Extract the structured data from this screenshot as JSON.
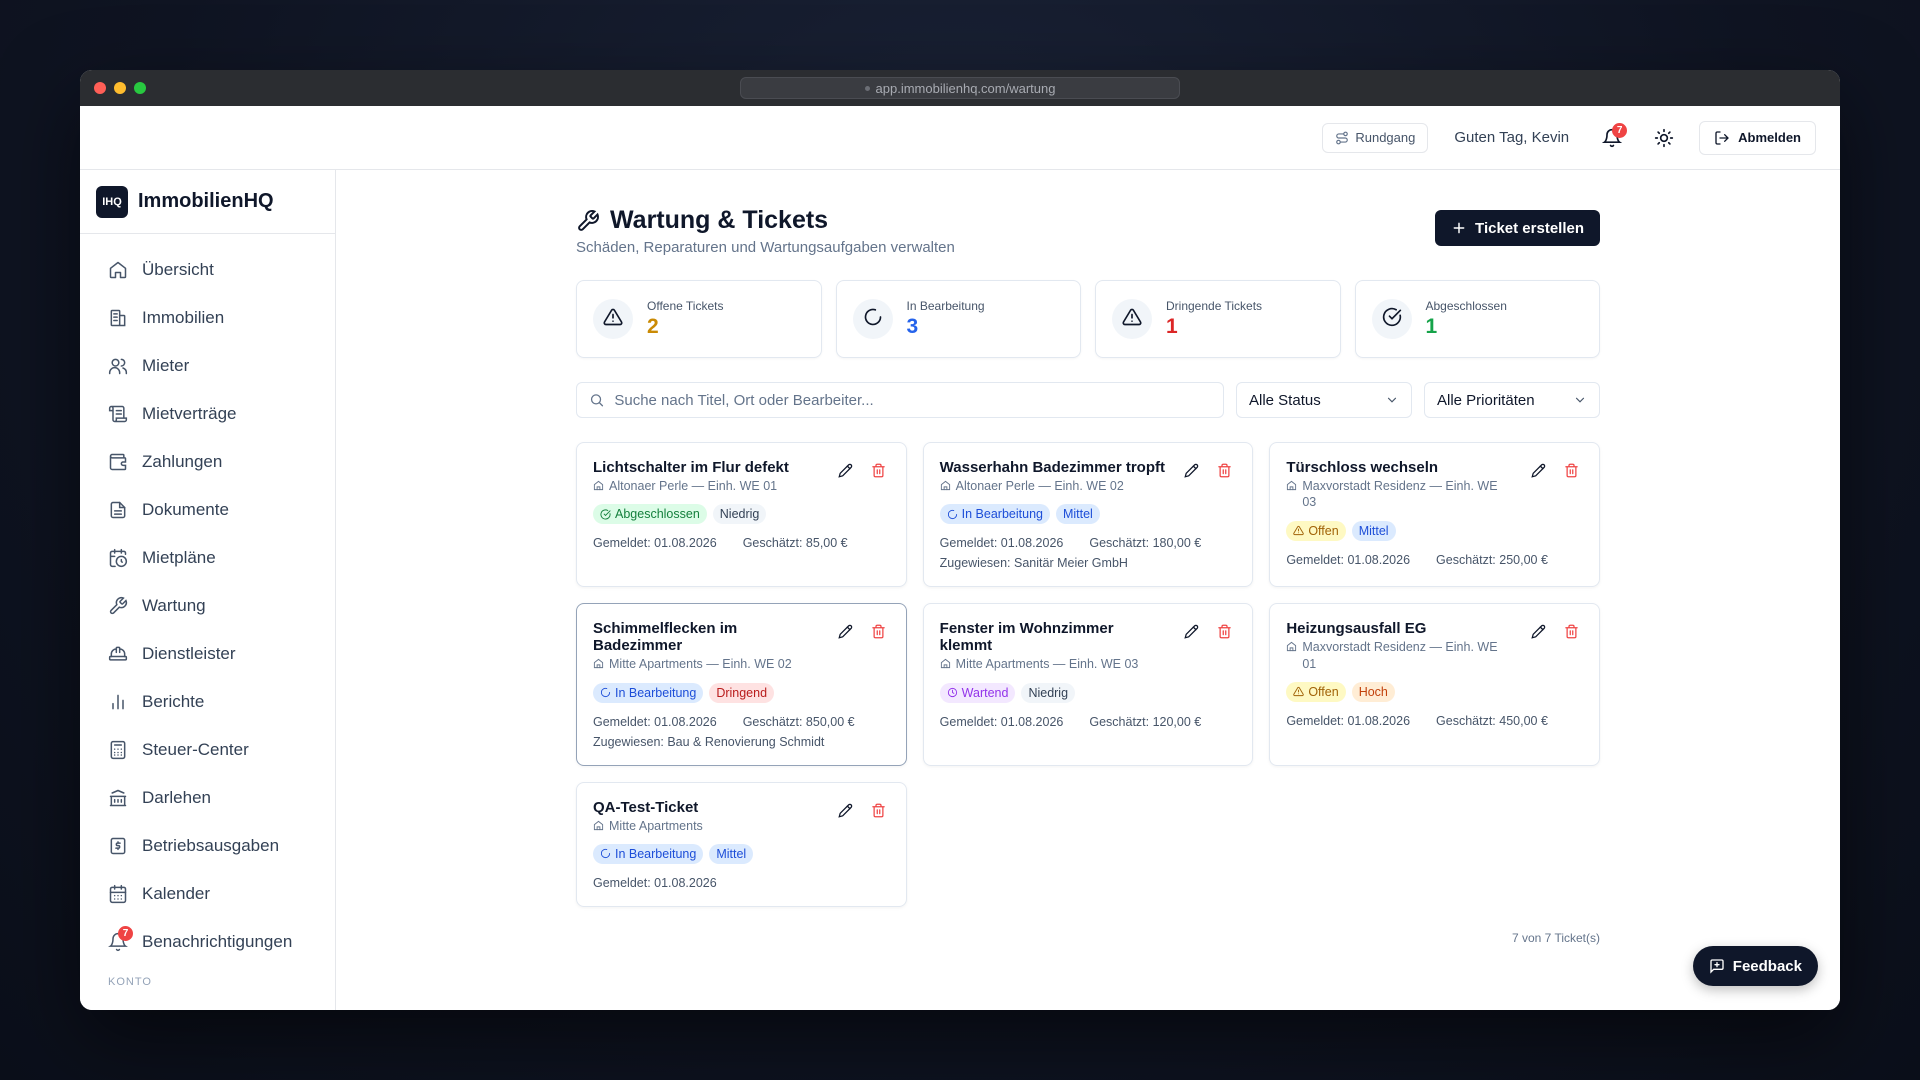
{
  "browser": {
    "url": "app.immobilienhq.com/wartung"
  },
  "topbar": {
    "tour_label": "Rundgang",
    "greeting": "Guten Tag, Kevin",
    "notification_count": "7",
    "logout_label": "Abmelden"
  },
  "brand": {
    "logo": "IHQ",
    "name": "ImmobilienHQ"
  },
  "sidebar": {
    "items": [
      {
        "label": "Übersicht",
        "icon": "home-icon"
      },
      {
        "label": "Immobilien",
        "icon": "building-icon"
      },
      {
        "label": "Mieter",
        "icon": "users-icon"
      },
      {
        "label": "Mietverträge",
        "icon": "scroll-icon"
      },
      {
        "label": "Zahlungen",
        "icon": "wallet-icon"
      },
      {
        "label": "Dokumente",
        "icon": "document-icon"
      },
      {
        "label": "Mietpläne",
        "icon": "calendar-clock-icon"
      },
      {
        "label": "Wartung",
        "icon": "wrench-icon"
      },
      {
        "label": "Dienstleister",
        "icon": "hard-hat-icon"
      },
      {
        "label": "Berichte",
        "icon": "bar-chart-icon"
      },
      {
        "label": "Steuer-Center",
        "icon": "calculator-icon"
      },
      {
        "label": "Darlehen",
        "icon": "bank-icon"
      },
      {
        "label": "Betriebsausgaben",
        "icon": "receipt-icon"
      },
      {
        "label": "Kalender",
        "icon": "calendar-icon"
      },
      {
        "label": "Benachrichtigungen",
        "icon": "bell-icon",
        "badge": "7"
      }
    ],
    "section_label": "KONTO"
  },
  "page": {
    "title": "Wartung & Tickets",
    "subtitle": "Schäden, Reparaturen und Wartungsaufgaben verwalten",
    "create_label": "Ticket erstellen"
  },
  "stats": [
    {
      "label": "Offene Tickets",
      "value": "2",
      "color": "#ca8a04",
      "icon": "warning-icon"
    },
    {
      "label": "In Bearbeitung",
      "value": "3",
      "color": "#2563eb",
      "icon": "spinner-icon"
    },
    {
      "label": "Dringende Tickets",
      "value": "1",
      "color": "#dc2626",
      "icon": "warning-icon"
    },
    {
      "label": "Abgeschlossen",
      "value": "1",
      "color": "#16a34a",
      "icon": "check-circle-icon"
    }
  ],
  "filters": {
    "search_placeholder": "Suche nach Titel, Ort oder Bearbeiter...",
    "status_value": "Alle Status",
    "priority_value": "Alle Prioritäten"
  },
  "tickets": [
    {
      "title": "Lichtschalter im Flur defekt",
      "location": "Altonaer Perle — Einh. WE 01",
      "status": "Abgeschlossen",
      "status_class": "b-done",
      "status_icon": "check-circle-icon",
      "priority": "Niedrig",
      "priority_class": "p-low",
      "reported": "Gemeldet: 01.08.2026",
      "estimate": "Geschätzt: 85,00 €",
      "assigned": ""
    },
    {
      "title": "Wasserhahn Badezimmer tropft",
      "location": "Altonaer Perle — Einh. WE 02",
      "status": "In Bearbeitung",
      "status_class": "b-prog",
      "status_icon": "spinner-icon",
      "priority": "Mittel",
      "priority_class": "p-mid",
      "reported": "Gemeldet: 01.08.2026",
      "estimate": "Geschätzt: 180,00 €",
      "assigned": "Zugewiesen: Sanitär Meier GmbH"
    },
    {
      "title": "Türschloss wechseln",
      "location": "Maxvorstadt Residenz — Einh. WE 03",
      "status": "Offen",
      "status_class": "b-open",
      "status_icon": "warning-icon",
      "priority": "Mittel",
      "priority_class": "p-mid",
      "reported": "Gemeldet: 01.08.2026",
      "estimate": "Geschätzt: 250,00 €",
      "assigned": ""
    },
    {
      "title": "Schimmelflecken im Badezimmer",
      "location": "Mitte Apartments — Einh. WE 02",
      "status": "In Bearbeitung",
      "status_class": "b-prog",
      "status_icon": "spinner-icon",
      "priority": "Dringend",
      "priority_class": "p-urgent",
      "reported": "Gemeldet: 01.08.2026",
      "estimate": "Geschätzt: 850,00 €",
      "assigned": "Zugewiesen: Bau & Renovierung Schmidt"
    },
    {
      "title": "Fenster im Wohnzimmer klemmt",
      "location": "Mitte Apartments — Einh. WE 03",
      "status": "Wartend",
      "status_class": "b-wait",
      "status_icon": "clock-icon",
      "priority": "Niedrig",
      "priority_class": "p-low",
      "reported": "Gemeldet: 01.08.2026",
      "estimate": "Geschätzt: 120,00 €",
      "assigned": ""
    },
    {
      "title": "Heizungsausfall EG",
      "location": "Maxvorstadt Residenz — Einh. WE 01",
      "status": "Offen",
      "status_class": "b-open",
      "status_icon": "warning-icon",
      "priority": "Hoch",
      "priority_class": "p-high",
      "reported": "Gemeldet: 01.08.2026",
      "estimate": "Geschätzt: 450,00 €",
      "assigned": ""
    },
    {
      "title": "QA-Test-Ticket",
      "location": "Mitte Apartments",
      "status": "In Bearbeitung",
      "status_class": "b-prog",
      "status_icon": "spinner-icon",
      "priority": "Mittel",
      "priority_class": "p-mid",
      "reported": "Gemeldet: 01.08.2026",
      "estimate": "",
      "assigned": ""
    }
  ],
  "footer": {
    "count_text": "7 von 7 Ticket(s)"
  },
  "feedback_label": "Feedback"
}
